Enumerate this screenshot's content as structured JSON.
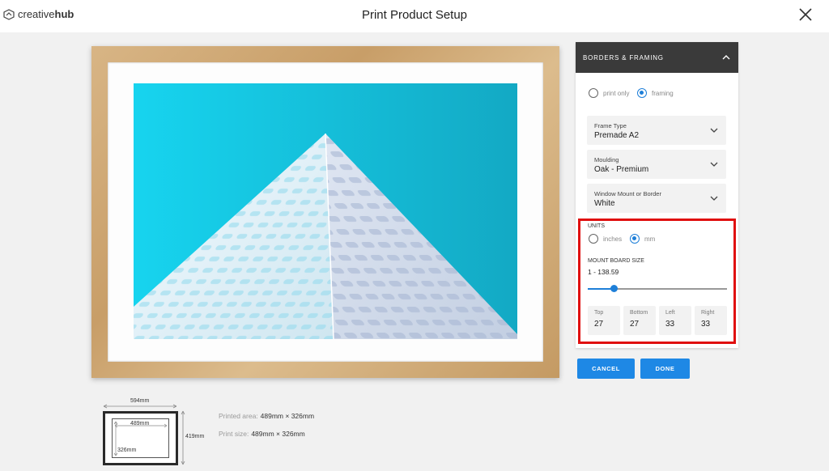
{
  "app": {
    "brand_light": "creative",
    "brand_bold": "hub",
    "title": "Print Product Setup"
  },
  "icons": {
    "logo": "creativehub-logo-icon",
    "close": "close-icon",
    "collapse": "chevron-up-icon",
    "dropdown": "chevron-down-icon"
  },
  "colors": {
    "accent": "#1e88e5",
    "panel_header": "#3a3a3a",
    "highlight": "#e01010",
    "frame": "#d4ad7a",
    "artwork_sky": "#1fc5e3"
  },
  "panel": {
    "header": "BORDERS & FRAMING",
    "mode_options": [
      {
        "label": "print only",
        "selected": false
      },
      {
        "label": "framing",
        "selected": true
      }
    ],
    "frame_type": {
      "label": "Frame Type",
      "value": "Premade A2"
    },
    "moulding": {
      "label": "Moulding",
      "value": "Oak - Premium"
    },
    "mount": {
      "label": "Window Mount or Border",
      "value": "White"
    },
    "units": {
      "label": "UNITS",
      "options": [
        {
          "label": "inches",
          "selected": false
        },
        {
          "label": "mm",
          "selected": true
        }
      ]
    },
    "mount_board": {
      "label": "MOUNT BOARD SIZE",
      "range": "1 - 138.59",
      "min": 1,
      "max": 138.59,
      "value": 27
    },
    "sizes": [
      {
        "label": "Top",
        "value": "27"
      },
      {
        "label": "Bottom",
        "value": "27"
      },
      {
        "label": "Left",
        "value": "33"
      },
      {
        "label": "Right",
        "value": "33"
      }
    ]
  },
  "buttons": {
    "cancel": "CANCEL",
    "done": "DONE"
  },
  "diagram": {
    "outer_width": "594mm",
    "outer_height": "419mm",
    "inner_width": "489mm",
    "inner_height": "326mm"
  },
  "info": {
    "printed_area_label": "Printed area:",
    "printed_area_value": "489mm × 326mm",
    "print_size_label": "Print size:",
    "print_size_value": "489mm × 326mm"
  }
}
